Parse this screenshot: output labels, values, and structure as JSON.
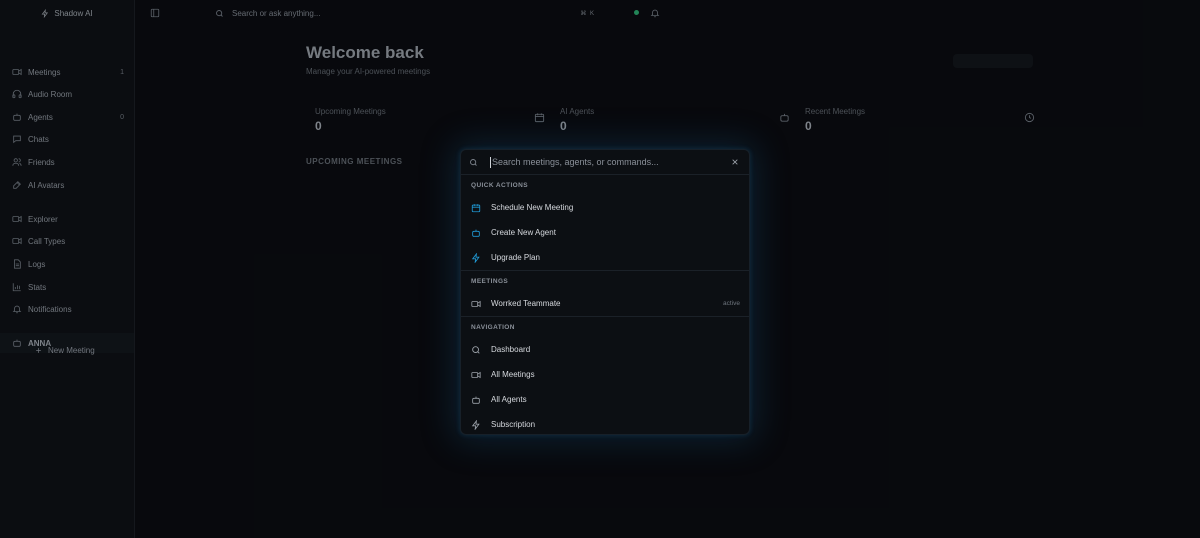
{
  "app": {
    "name": "Shadow AI"
  },
  "topbar": {
    "search_placeholder": "Search or ask anything...",
    "shortcut": "⌘ K"
  },
  "sidebar": {
    "items": [
      {
        "label": "Meetings",
        "count": "1",
        "icon": "video-icon"
      },
      {
        "label": "Audio Room",
        "count": "",
        "icon": "headphones-icon"
      },
      {
        "label": "Agents",
        "count": "0",
        "icon": "bot-icon"
      },
      {
        "label": "Chats",
        "count": "",
        "icon": "chat-icon"
      },
      {
        "label": "Friends",
        "count": "",
        "icon": "users-icon"
      },
      {
        "label": "AI Avatars",
        "count": "",
        "icon": "sparkle-icon"
      },
      {
        "label": "Explorer",
        "count": "",
        "icon": "video-icon"
      },
      {
        "label": "Call Types",
        "count": "",
        "icon": "video-icon"
      },
      {
        "label": "Logs",
        "count": "",
        "icon": "document-icon"
      },
      {
        "label": "Stats",
        "count": "",
        "icon": "chart-icon"
      },
      {
        "label": "Notifications",
        "count": "",
        "icon": "bell-icon"
      }
    ],
    "selected_agent": "ANNA",
    "new_meeting_label": "New Meeting"
  },
  "main": {
    "title": "Welcome back",
    "subtitle": "Manage your AI-powered meetings",
    "stats": [
      {
        "label": "Upcoming Meetings",
        "value": "0",
        "icon": "calendar-icon"
      },
      {
        "label": "AI Agents",
        "value": "0",
        "icon": "bot-icon"
      },
      {
        "label": "Recent Meetings",
        "value": "0",
        "icon": "clock-icon"
      }
    ],
    "section_title": "UPCOMING MEETINGS"
  },
  "palette": {
    "placeholder": "Search meetings, agents, or commands...",
    "groups": [
      {
        "title": "QUICK ACTIONS",
        "items": [
          {
            "label": "Schedule New Meeting",
            "meta": "",
            "icon": "calendar-icon"
          },
          {
            "label": "Create New Agent",
            "meta": "",
            "icon": "bot-icon"
          },
          {
            "label": "Upgrade Plan",
            "meta": "",
            "icon": "lightning-icon"
          }
        ]
      },
      {
        "title": "MEETINGS",
        "items": [
          {
            "label": "Worrked Teammate",
            "meta": "active",
            "icon": "video-icon"
          }
        ]
      },
      {
        "title": "NAVIGATION",
        "items": [
          {
            "label": "Dashboard",
            "meta": "",
            "icon": "search-icon"
          },
          {
            "label": "All Meetings",
            "meta": "",
            "icon": "video-icon"
          },
          {
            "label": "All Agents",
            "meta": "",
            "icon": "bot-icon"
          },
          {
            "label": "Subscription",
            "meta": "",
            "icon": "lightning-icon"
          }
        ]
      }
    ]
  },
  "colors": {
    "accent": "#1f9ad6",
    "status_online": "#2aa36b",
    "background": "#0a0c10"
  }
}
